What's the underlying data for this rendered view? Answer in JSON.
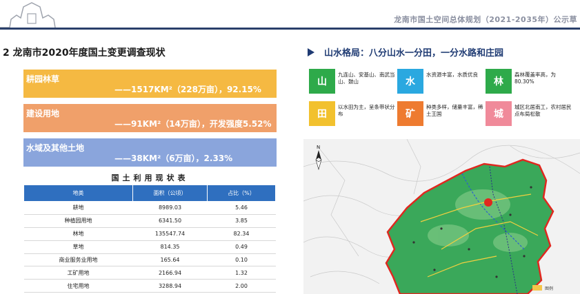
{
  "header": {
    "title": "龙南市国土空间总体规划（2021-2035年）公示草"
  },
  "section_title": "2  龙南市2020年度国土变更调查现状",
  "summary_bands": [
    {
      "label": "耕园林草",
      "value": "——1517KM²（228万亩），92.15%",
      "color": "#f5b942"
    },
    {
      "label": "建设用地",
      "value": "——91KM²（14万亩），开发强度5.52%",
      "color": "#f0a06a"
    },
    {
      "label": "水域及其他土地",
      "value": "——38KM²（6万亩），2.33%",
      "color": "#8aa5dc"
    }
  ],
  "table": {
    "title": "国土利用现状表",
    "headers": [
      "地类",
      "面积（公顷）",
      "占比（%）"
    ],
    "rows": [
      [
        "耕地",
        "8989.03",
        "5.46"
      ],
      [
        "种植园用地",
        "6341.50",
        "3.85"
      ],
      [
        "林地",
        "135547.74",
        "82.34"
      ],
      [
        "草地",
        "814.35",
        "0.49"
      ],
      [
        "商业服务业用地",
        "165.64",
        "0.10"
      ],
      [
        "工矿用地",
        "2166.94",
        "1.32"
      ],
      [
        "住宅用地",
        "3288.94",
        "2.00"
      ]
    ]
  },
  "right_title": "山水格局：八分山水一分田，一分水路和庄园",
  "legend": [
    {
      "char": "山",
      "color": "#2eaa4a",
      "text": "九连山、安基山、南武当山、鼓山"
    },
    {
      "char": "水",
      "color": "#2aa8e0",
      "text": "水资源丰富，水质优良"
    },
    {
      "char": "林",
      "color": "#2eaa4a",
      "text": "森林覆盖率高，为80.30%"
    },
    {
      "char": "田",
      "color": "#f2c12e",
      "text": "以水田为主，呈条带状分布"
    },
    {
      "char": "矿",
      "color": "#ee7b30",
      "text": "种类多样，储量丰富，稀土王国"
    },
    {
      "char": "城",
      "color": "#f08a9a",
      "text": "城区北居南工，农村居民点布局松散"
    }
  ],
  "map": {
    "compass_label": "N",
    "legend_text": "图例"
  }
}
